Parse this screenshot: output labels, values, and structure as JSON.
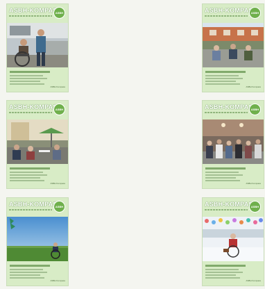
{
  "covers": [
    {
      "brand": "ASBH-KOMPASS",
      "badge": "ASBH",
      "issue": "ASBH Kompass",
      "photo": "workshop-wheelchair-photo"
    },
    {
      "brand": "ASBH-KOMPASS",
      "badge": "ASBH",
      "issue": "ASBH Kompass",
      "photo": "courtyard-group-photo"
    },
    {
      "brand": "ASBH-KOMPASS",
      "badge": "ASBH",
      "issue": "ASBH Kompass",
      "photo": "garden-party-photo"
    },
    {
      "brand": "ASBH-KOMPASS",
      "badge": "ASBH",
      "issue": "ASBH Kompass",
      "photo": "hall-group-photo"
    },
    {
      "brand": "ASBH-KOMPASS",
      "badge": "ASBH",
      "issue": "ASBH Kompass",
      "photo": "field-wheelchair-photo"
    },
    {
      "brand": "ASBH-KOMPASS",
      "badge": "ASBH",
      "issue": "ASBH Kompass",
      "photo": "snow-wheelchair-photo"
    }
  ],
  "colors": {
    "background": "#f4f5f0",
    "cover_green": "#d8ecc6",
    "badge_green": "#6fb04c",
    "text_green": "#5e8c4a"
  }
}
